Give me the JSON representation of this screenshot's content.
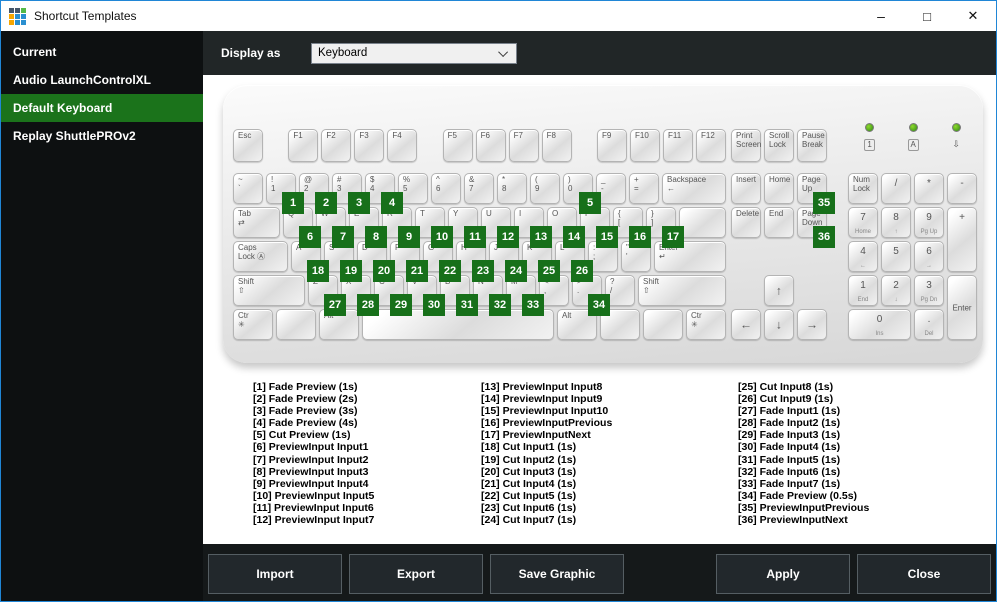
{
  "window": {
    "title": "Shortcut Templates",
    "controls": {
      "minimize": "–",
      "maximize": "□",
      "close": "✕"
    },
    "icon_colors": [
      "#44566b",
      "#44566b",
      "#53b948",
      "#f7a600",
      "#2a8fd0",
      "#2a8fd0",
      "#f7a600",
      "#2a8fd0",
      "#2a8fd0"
    ]
  },
  "colors": {
    "badge_green": "#17701a",
    "selected_green": "#1b731b",
    "window_border": "#2086d6"
  },
  "sidebar": {
    "items": [
      {
        "label": "Current",
        "selected": false
      },
      {
        "label": "Audio LaunchControlXL",
        "selected": false
      },
      {
        "label": "Default Keyboard",
        "selected": true
      },
      {
        "label": "Replay ShuttlePROv2",
        "selected": false
      }
    ]
  },
  "toolbar": {
    "display_as_label": "Display as",
    "display_as_value": "Keyboard"
  },
  "keyboard": {
    "function_row": [
      {
        "t": "Esc",
        "id": "esc"
      },
      {
        "sp": true
      },
      {
        "t": "F1"
      },
      {
        "t": "F2"
      },
      {
        "t": "F3"
      },
      {
        "t": "F4"
      },
      {
        "sp": true
      },
      {
        "t": "F5"
      },
      {
        "t": "F6"
      },
      {
        "t": "F7"
      },
      {
        "t": "F8"
      },
      {
        "sp": true
      },
      {
        "t": "F9"
      },
      {
        "t": "F10"
      },
      {
        "t": "F11"
      },
      {
        "t": "F12"
      }
    ],
    "system_keys": [
      {
        "t": "Print",
        "b": "Screen",
        "id": "print-screen"
      },
      {
        "t": "Scroll",
        "b": "Lock",
        "id": "scroll-lock"
      },
      {
        "t": "Pause",
        "b": "Break",
        "id": "pause-break"
      }
    ],
    "leds": [
      {
        "sym": "1",
        "boxed": true,
        "id": "num-lock-led"
      },
      {
        "sym": "A",
        "boxed": true,
        "id": "caps-lock-led"
      },
      {
        "sym": "⇩",
        "boxed": false,
        "id": "scroll-lock-led"
      }
    ],
    "main_rows": [
      [
        {
          "t": "~",
          "b": "`",
          "id": "grave"
        },
        {
          "t": "!",
          "b": "1",
          "id": "1",
          "badge": 1
        },
        {
          "t": "@",
          "b": "2",
          "id": "2",
          "badge": 2
        },
        {
          "t": "#",
          "b": "3",
          "id": "3",
          "badge": 3
        },
        {
          "t": "$",
          "b": "4",
          "id": "4",
          "badge": 4
        },
        {
          "t": "%",
          "b": "5",
          "id": "5"
        },
        {
          "t": "^",
          "b": "6",
          "id": "6"
        },
        {
          "t": "&",
          "b": "7",
          "id": "7"
        },
        {
          "t": "*",
          "b": "8",
          "id": "8"
        },
        {
          "t": "(",
          "b": "9",
          "id": "9"
        },
        {
          "t": ")",
          "b": "0",
          "id": "0",
          "badge": 5
        },
        {
          "t": "_",
          "b": "-",
          "id": "minus"
        },
        {
          "t": "+",
          "b": "=",
          "id": "equals"
        },
        {
          "t": "Backspace",
          "b": "←",
          "id": "backspace",
          "w": "w2"
        }
      ],
      [
        {
          "t": "Tab",
          "b": "⇄",
          "id": "tab",
          "w": "w15"
        },
        {
          "t": "Q",
          "badge": 6
        },
        {
          "t": "W",
          "badge": 7
        },
        {
          "t": "E",
          "badge": 8
        },
        {
          "t": "R",
          "badge": 9
        },
        {
          "t": "T",
          "badge": 10
        },
        {
          "t": "Y",
          "badge": 11
        },
        {
          "t": "U",
          "badge": 12
        },
        {
          "t": "I",
          "badge": 13
        },
        {
          "t": "O",
          "badge": 14
        },
        {
          "t": "P",
          "badge": 15
        },
        {
          "t": "{",
          "b": "[",
          "id": "left-bracket",
          "badge": 16
        },
        {
          "t": "}",
          "b": "]",
          "id": "right-bracket",
          "badge": 17
        },
        {
          "t": "",
          "id": "backslash",
          "w": "w15"
        }
      ],
      [
        {
          "t": "Caps",
          "b": "Lock Ⓐ",
          "id": "caps-lock",
          "w": "w175"
        },
        {
          "t": "A",
          "badge": 18
        },
        {
          "t": "S",
          "badge": 19
        },
        {
          "t": "D",
          "badge": 20
        },
        {
          "t": "F",
          "badge": 21
        },
        {
          "t": "G",
          "badge": 22
        },
        {
          "t": "H",
          "badge": 23
        },
        {
          "t": "J",
          "badge": 24
        },
        {
          "t": "K",
          "badge": 25
        },
        {
          "t": "L",
          "badge": 26
        },
        {
          "t": ":",
          "b": ";",
          "id": "semicolon"
        },
        {
          "t": "\"",
          "b": "'",
          "id": "quote"
        },
        {
          "t": "Enter",
          "b": "↵",
          "id": "enter",
          "w": "w225"
        }
      ],
      [
        {
          "t": "Shift",
          "b": "⇧",
          "id": "shift-left",
          "w": "w225"
        },
        {
          "t": "Z",
          "badge": 27
        },
        {
          "t": "X",
          "badge": 28
        },
        {
          "t": "C",
          "badge": 29
        },
        {
          "t": "V",
          "badge": 30
        },
        {
          "t": "B",
          "badge": 31
        },
        {
          "t": "N",
          "badge": 32
        },
        {
          "t": "M",
          "badge": 33
        },
        {
          "t": "<",
          "b": ",",
          "id": "comma"
        },
        {
          "t": ">",
          "b": ".",
          "id": "period",
          "badge": 34
        },
        {
          "t": "?",
          "b": "/",
          "id": "slash"
        },
        {
          "t": "Shift",
          "b": "⇧",
          "id": "shift-right",
          "w": "w275"
        }
      ],
      [
        {
          "t": "Ctr",
          "b": "✳",
          "id": "ctrl-left",
          "w": "wmod"
        },
        {
          "t": "",
          "id": "win-left",
          "w": "wmod"
        },
        {
          "t": "Alt",
          "id": "alt-left",
          "w": "wmod"
        },
        {
          "t": "",
          "id": "space",
          "w": "wspace"
        },
        {
          "t": "Alt",
          "id": "alt-right",
          "w": "wmod"
        },
        {
          "t": "",
          "id": "win-right",
          "w": "wmod"
        },
        {
          "t": "",
          "id": "menu",
          "w": "wmod"
        },
        {
          "t": "Ctr",
          "b": "✳",
          "id": "ctrl-right",
          "w": "wmod"
        }
      ]
    ],
    "nav_rows": [
      [
        {
          "t": "Insert",
          "id": "insert"
        },
        {
          "t": "Home",
          "id": "home"
        },
        {
          "t": "Page",
          "b": "Up",
          "id": "page-up",
          "badge": 35
        }
      ],
      [
        {
          "t": "Delete",
          "id": "delete"
        },
        {
          "t": "End",
          "id": "end"
        },
        {
          "t": "Page",
          "b": "Down",
          "id": "page-down",
          "badge": 36
        }
      ]
    ],
    "arrow_up": {
      "t": "↑",
      "id": "arrow-up"
    },
    "arrow_row": [
      {
        "t": "←",
        "id": "arrow-left"
      },
      {
        "t": "↓",
        "id": "arrow-down"
      },
      {
        "t": "→",
        "id": "arrow-right"
      }
    ],
    "numpad": [
      {
        "t": "Num",
        "b": "Lock",
        "two": true,
        "id": "num-lock",
        "c": 1,
        "r": 1
      },
      {
        "t": "/",
        "id": "np-divide",
        "c": 2,
        "r": 1
      },
      {
        "t": "*",
        "id": "np-multiply",
        "c": 3,
        "r": 1
      },
      {
        "t": "-",
        "id": "np-minus",
        "c": 4,
        "r": 1
      },
      {
        "t": "7",
        "sub": "Home",
        "id": "np-7",
        "c": 1,
        "r": 2
      },
      {
        "t": "8",
        "sub": "↑",
        "id": "np-8",
        "c": 2,
        "r": 2
      },
      {
        "t": "9",
        "sub": "Pg Up",
        "id": "np-9",
        "c": 3,
        "r": 2
      },
      {
        "t": "+",
        "id": "np-plus",
        "c": 4,
        "r": 2,
        "rs": 2
      },
      {
        "t": "4",
        "sub": "←",
        "id": "np-4",
        "c": 1,
        "r": 3
      },
      {
        "t": "5",
        "id": "np-5",
        "c": 2,
        "r": 3
      },
      {
        "t": "6",
        "sub": "→",
        "id": "np-6",
        "c": 3,
        "r": 3
      },
      {
        "t": "1",
        "sub": "End",
        "id": "np-1",
        "c": 1,
        "r": 4
      },
      {
        "t": "2",
        "sub": "↓",
        "id": "np-2",
        "c": 2,
        "r": 4
      },
      {
        "t": "3",
        "sub": "Pg Dn",
        "id": "np-3",
        "c": 3,
        "r": 4
      },
      {
        "t": "Enter",
        "enter": true,
        "id": "np-enter",
        "c": 4,
        "r": 4,
        "rs": 2
      },
      {
        "t": "0",
        "sub": "Ins",
        "id": "np-0",
        "c": 1,
        "r": 5,
        "cs": 2
      },
      {
        "t": ".",
        "sub": "Del",
        "id": "np-dot",
        "c": 3,
        "r": 5
      }
    ]
  },
  "legend": {
    "columns": [
      [
        "[1] Fade Preview (1s)",
        "[2] Fade Preview (2s)",
        "[3] Fade Preview (3s)",
        "[4] Fade Preview (4s)",
        "[5] Cut Preview (1s)",
        "[6] PreviewInput Input1",
        "[7] PreviewInput Input2",
        "[8] PreviewInput Input3",
        "[9] PreviewInput Input4",
        "[10] PreviewInput Input5",
        "[11] PreviewInput Input6",
        "[12] PreviewInput Input7"
      ],
      [
        "[13] PreviewInput Input8",
        "[14] PreviewInput Input9",
        "[15] PreviewInput Input10",
        "[16] PreviewInputPrevious",
        "[17] PreviewInputNext",
        "[18] Cut Input1 (1s)",
        "[19] Cut Input2 (1s)",
        "[20] Cut Input3 (1s)",
        "[21] Cut Input4 (1s)",
        "[22] Cut Input5 (1s)",
        "[23] Cut Input6 (1s)",
        "[24] Cut Input7 (1s)"
      ],
      [
        "[25] Cut Input8 (1s)",
        "[26] Cut Input9 (1s)",
        "[27] Fade Input1 (1s)",
        "[28] Fade Input2 (1s)",
        "[29] Fade Input3 (1s)",
        "[30] Fade Input4 (1s)",
        "[31] Fade Input5 (1s)",
        "[32] Fade Input6 (1s)",
        "[33] Fade Input7 (1s)",
        "[34] Fade Preview (0.5s)",
        "[35] PreviewInputPrevious",
        "[36] PreviewInputNext"
      ]
    ]
  },
  "footer": {
    "buttons": [
      {
        "label": "Import"
      },
      {
        "label": "Export"
      },
      {
        "label": "Save Graphic"
      },
      {
        "label": "Apply",
        "push": true
      },
      {
        "label": "Close"
      }
    ]
  }
}
